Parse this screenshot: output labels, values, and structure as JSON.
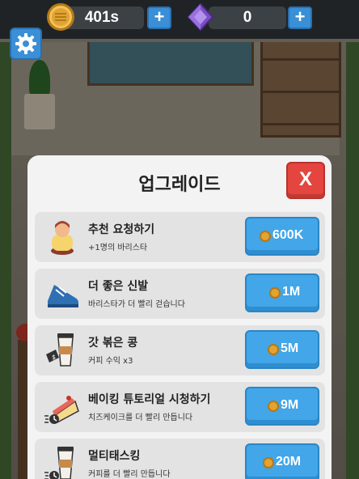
{
  "topbar": {
    "coins": "401s",
    "gems": "0",
    "add_coins_label": "+",
    "add_gems_label": "+"
  },
  "icons": {
    "coin": "coin-icon",
    "gem": "gem-icon",
    "settings": "gear-icon"
  },
  "modal": {
    "title": "업그레이드",
    "close_label": "X",
    "items": [
      {
        "name": "추천 요청하기",
        "desc": "+1명의 바리스타",
        "price": "600K",
        "icon": "barista-icon"
      },
      {
        "name": "더 좋은 신발",
        "desc": "바리스타가 더 빨리 걷습니다",
        "price": "1M",
        "icon": "shoe-icon"
      },
      {
        "name": "갓 볶은 콩",
        "desc": "커피 수익 x3",
        "price": "5M",
        "icon": "coffee-cup-icon"
      },
      {
        "name": "베이킹 튜토리얼 시청하기",
        "desc": "치즈케이크를 더 빨리 만듭니다",
        "price": "9M",
        "icon": "cheesecake-icon"
      },
      {
        "name": "멀티태스킹",
        "desc": "커피를 더 빨리 만듭니다",
        "price": "20M",
        "icon": "multitask-coffee-icon"
      }
    ]
  },
  "colors": {
    "button_blue": "#42a6e8",
    "close_red": "#e4453e",
    "coin_gold": "#e0a434",
    "gem_purple": "#7b4fc4"
  }
}
